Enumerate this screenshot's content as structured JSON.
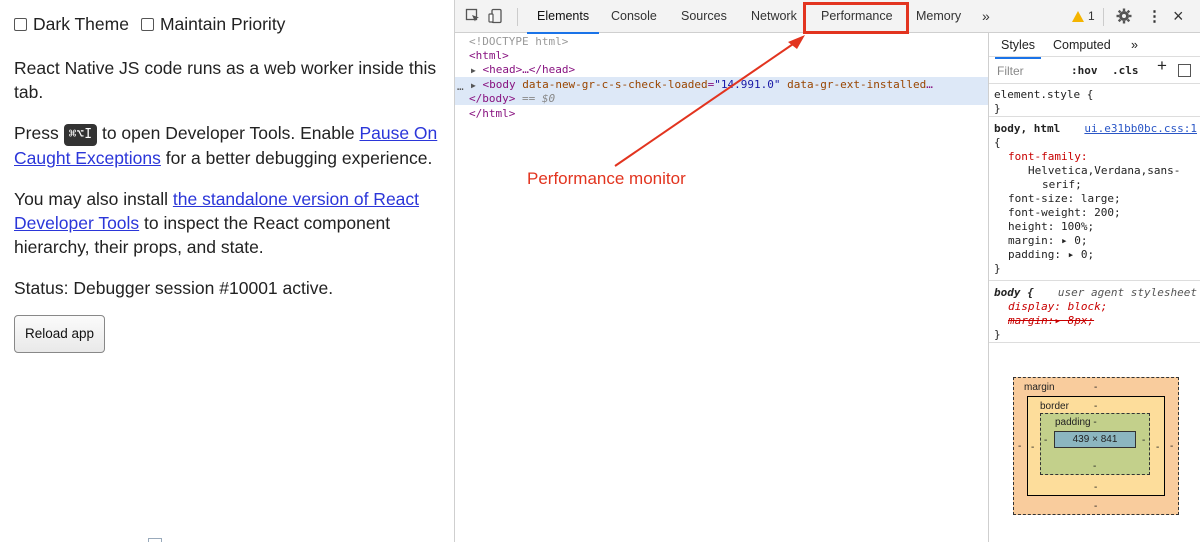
{
  "left": {
    "checkbox_dark": "Dark Theme",
    "checkbox_priority": "Maintain Priority",
    "p1": "React Native JS code runs as a web worker inside this tab.",
    "p2_pre": "Press ",
    "p2_kbd": "⌘⌥I",
    "p2_mid": " to open Developer Tools. Enable ",
    "p2_link": "Pause On Caught Exceptions",
    "p2_post": " for a better debugging experience.",
    "p3_pre": "You may also install ",
    "p3_link": "the standalone version of React Developer Tools",
    "p3_post": " to inspect the React component hierarchy, their props, and state.",
    "status": "Status: Debugger session #10001 active.",
    "reload": "Reload app"
  },
  "devtools": {
    "tabs": [
      "Elements",
      "Console",
      "Sources",
      "Network",
      "Performance",
      "Memory"
    ],
    "more": "»",
    "warning_count": "1",
    "close": "×",
    "menu": "⋮",
    "elements": {
      "doctype": "<!DOCTYPE html>",
      "html_open": "<html>",
      "head": "<head>…</head>",
      "body_tag": "<body",
      "body_attr1": "data-new-gr-c-s-check-loaded",
      "body_val1": "\"14.991.0\"",
      "body_attr2": "data-gr-ext-installed",
      "body_close": "</body>",
      "eq0": "== $0",
      "html_close": "</html>"
    },
    "annotation": "Performance monitor",
    "styles": {
      "tab_styles": "Styles",
      "tab_computed": "Computed",
      "tab_more": "»",
      "filter_placeholder": "Filter",
      "hov": ":hov",
      "cls": ".cls",
      "plus": "+",
      "element_style": "element.style {",
      "close_brace": "}",
      "selector": "body, html",
      "source": "ui.e31bb0bc.css:1",
      "open_brace": "{",
      "ff_prop": "font-family:",
      "ff_val1": "Helvetica,Verdana,sans-",
      "ff_val2": "serif;",
      "fs": "font-size: large;",
      "fw": "font-weight: 200;",
      "h": "height: 100%;",
      "m": "margin: ▸ 0;",
      "p": "padding: ▸ 0;",
      "ua_selector": "body {",
      "ua_source": "user agent stylesheet",
      "ua_display": "display: block;",
      "ua_margin": "margin:▸ 8px;"
    },
    "boxmodel": {
      "margin": "margin",
      "border": "border",
      "padding": "padding -",
      "dash": "-",
      "content": "439 × 841"
    }
  }
}
